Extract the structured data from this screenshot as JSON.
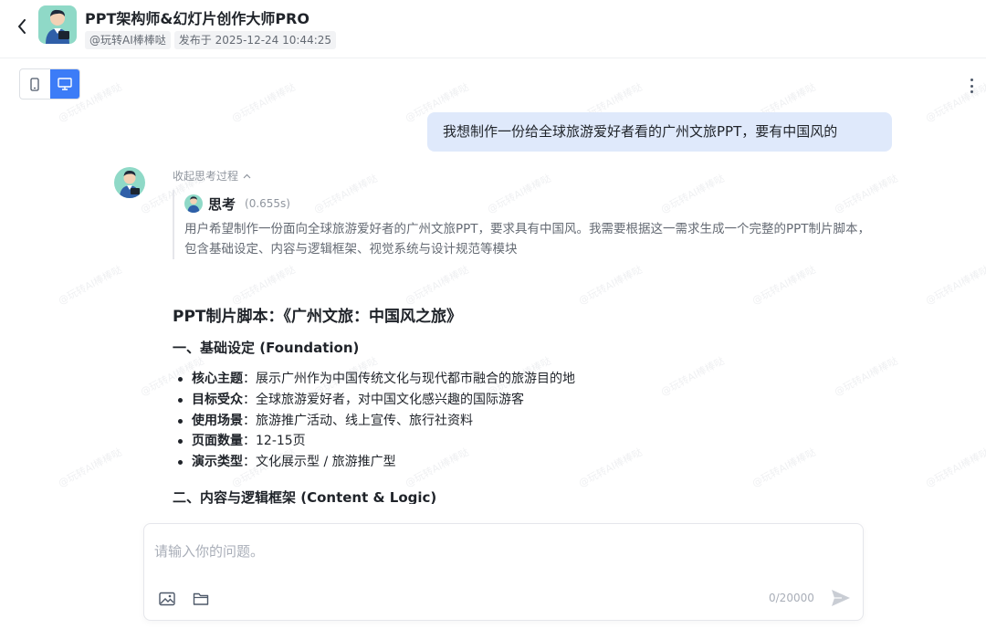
{
  "header": {
    "title": "PPT架构师&幻灯片创作大师PRO",
    "author": "@玩转AI棒棒哒",
    "published": "发布于 2025-12-24 10:44:25"
  },
  "view_toggle": {
    "options": [
      "mobile-view",
      "desktop-view"
    ],
    "active": "desktop-view",
    "accent": "#3c7cf7"
  },
  "watermark": "@玩转AI棒棒哒",
  "messages": {
    "user": "我想制作一份给全球旅游爱好者看的广州文旅PPT，要有中国风的",
    "bot": {
      "collapse_label": "收起思考过程",
      "thinking_label": "思考",
      "thinking_time": "(0.655s)",
      "thinking_text": "用户希望制作一份面向全球旅游爱好者的广州文旅PPT，要求具有中国风。我需要根据这一需求生成一个完整的PPT制片脚本，包含基础设定、内容与逻辑框架、视觉系统与设计规范等模块",
      "doc_title": "PPT制片脚本：《广州文旅：中国风之旅》",
      "section1_heading": "一、基础设定 (Foundation)",
      "section1_items": [
        {
          "label": "核心主题",
          "value": "：展示广州作为中国传统文化与现代都市融合的旅游目的地"
        },
        {
          "label": "目标受众",
          "value": "：全球旅游爱好者，对中国文化感兴趣的国际游客"
        },
        {
          "label": "使用场景",
          "value": "：旅游推广活动、线上宣传、旅行社资料"
        },
        {
          "label": "页面数量",
          "value": "：12-15页"
        },
        {
          "label": "演示类型",
          "value": "：文化展示型 / 旅游推广型"
        }
      ],
      "section2_heading": "二、内容与逻辑框架 (Content & Logic)"
    }
  },
  "input": {
    "placeholder": "请输入你的问题。",
    "value": "",
    "char_count": "0/20000"
  }
}
